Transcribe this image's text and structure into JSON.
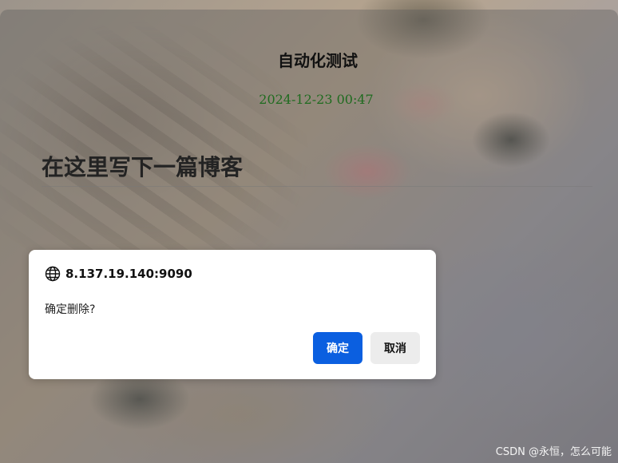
{
  "page": {
    "title": "自动化测试",
    "datetime": "2024-12-23 00:47",
    "post_heading": "在这里写下一篇博客"
  },
  "dialog": {
    "origin": "8.137.19.140:9090",
    "origin_icon": "globe-icon",
    "message": "确定删除?",
    "ok_label": "确定",
    "cancel_label": "取消"
  },
  "watermark": "CSDN @永恒，怎么可能",
  "colors": {
    "ok_button": "#0b5fe0",
    "cancel_button": "#ececec",
    "datetime_text": "#1f6b1f"
  }
}
